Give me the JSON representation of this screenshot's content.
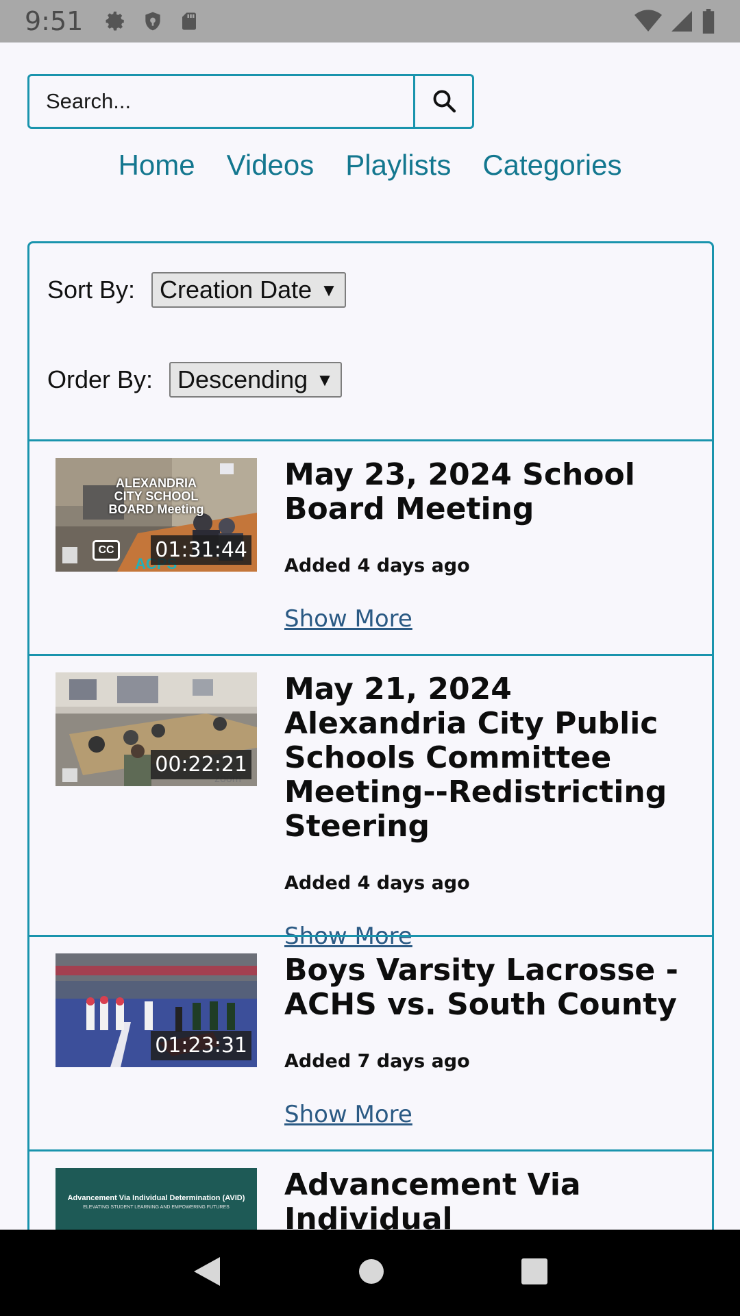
{
  "status_bar": {
    "time": "9:51",
    "left_icons": [
      "gear-icon",
      "shield-icon",
      "sd-card-icon"
    ],
    "right_icons": [
      "wifi-icon",
      "signal-icon",
      "battery-icon"
    ]
  },
  "search": {
    "placeholder": "Search..."
  },
  "nav": {
    "items": [
      "Home",
      "Videos",
      "Playlists",
      "Categories"
    ]
  },
  "sort": {
    "sort_label": "Sort By:",
    "sort_value": "Creation Date",
    "order_label": "Order By:",
    "order_value": "Descending"
  },
  "videos": [
    {
      "title": "May 23, 2024 School Board Meeting",
      "added": "Added 4 days ago",
      "duration": "01:31:44",
      "thumb_text": "ALEXANDRIA CITY SCHOOL BOARD Meeting",
      "cc": "CC",
      "show_more": "Show More"
    },
    {
      "title": "May 21, 2024 Alexandria City Public Schools Committee Meeting--Redistricting Steering",
      "added": "Added 4 days ago",
      "duration": "00:22:21",
      "show_more": "Show More"
    },
    {
      "title": "Boys Varsity Lacrosse - ACHS vs. South County",
      "added": "Added 7 days ago",
      "duration": "01:23:31",
      "show_more": "Show More"
    },
    {
      "title": "Advancement Via Individual Determination",
      "thumb_text": "Advancement Via Individual Determination (AVID)",
      "thumb_subtext": "ELEVATING STUDENT LEARNING AND EMPOWERING FUTURES"
    }
  ],
  "colors": {
    "accent": "#1a94ad",
    "nav_link": "#13778f",
    "show_more": "#2b5a84"
  }
}
